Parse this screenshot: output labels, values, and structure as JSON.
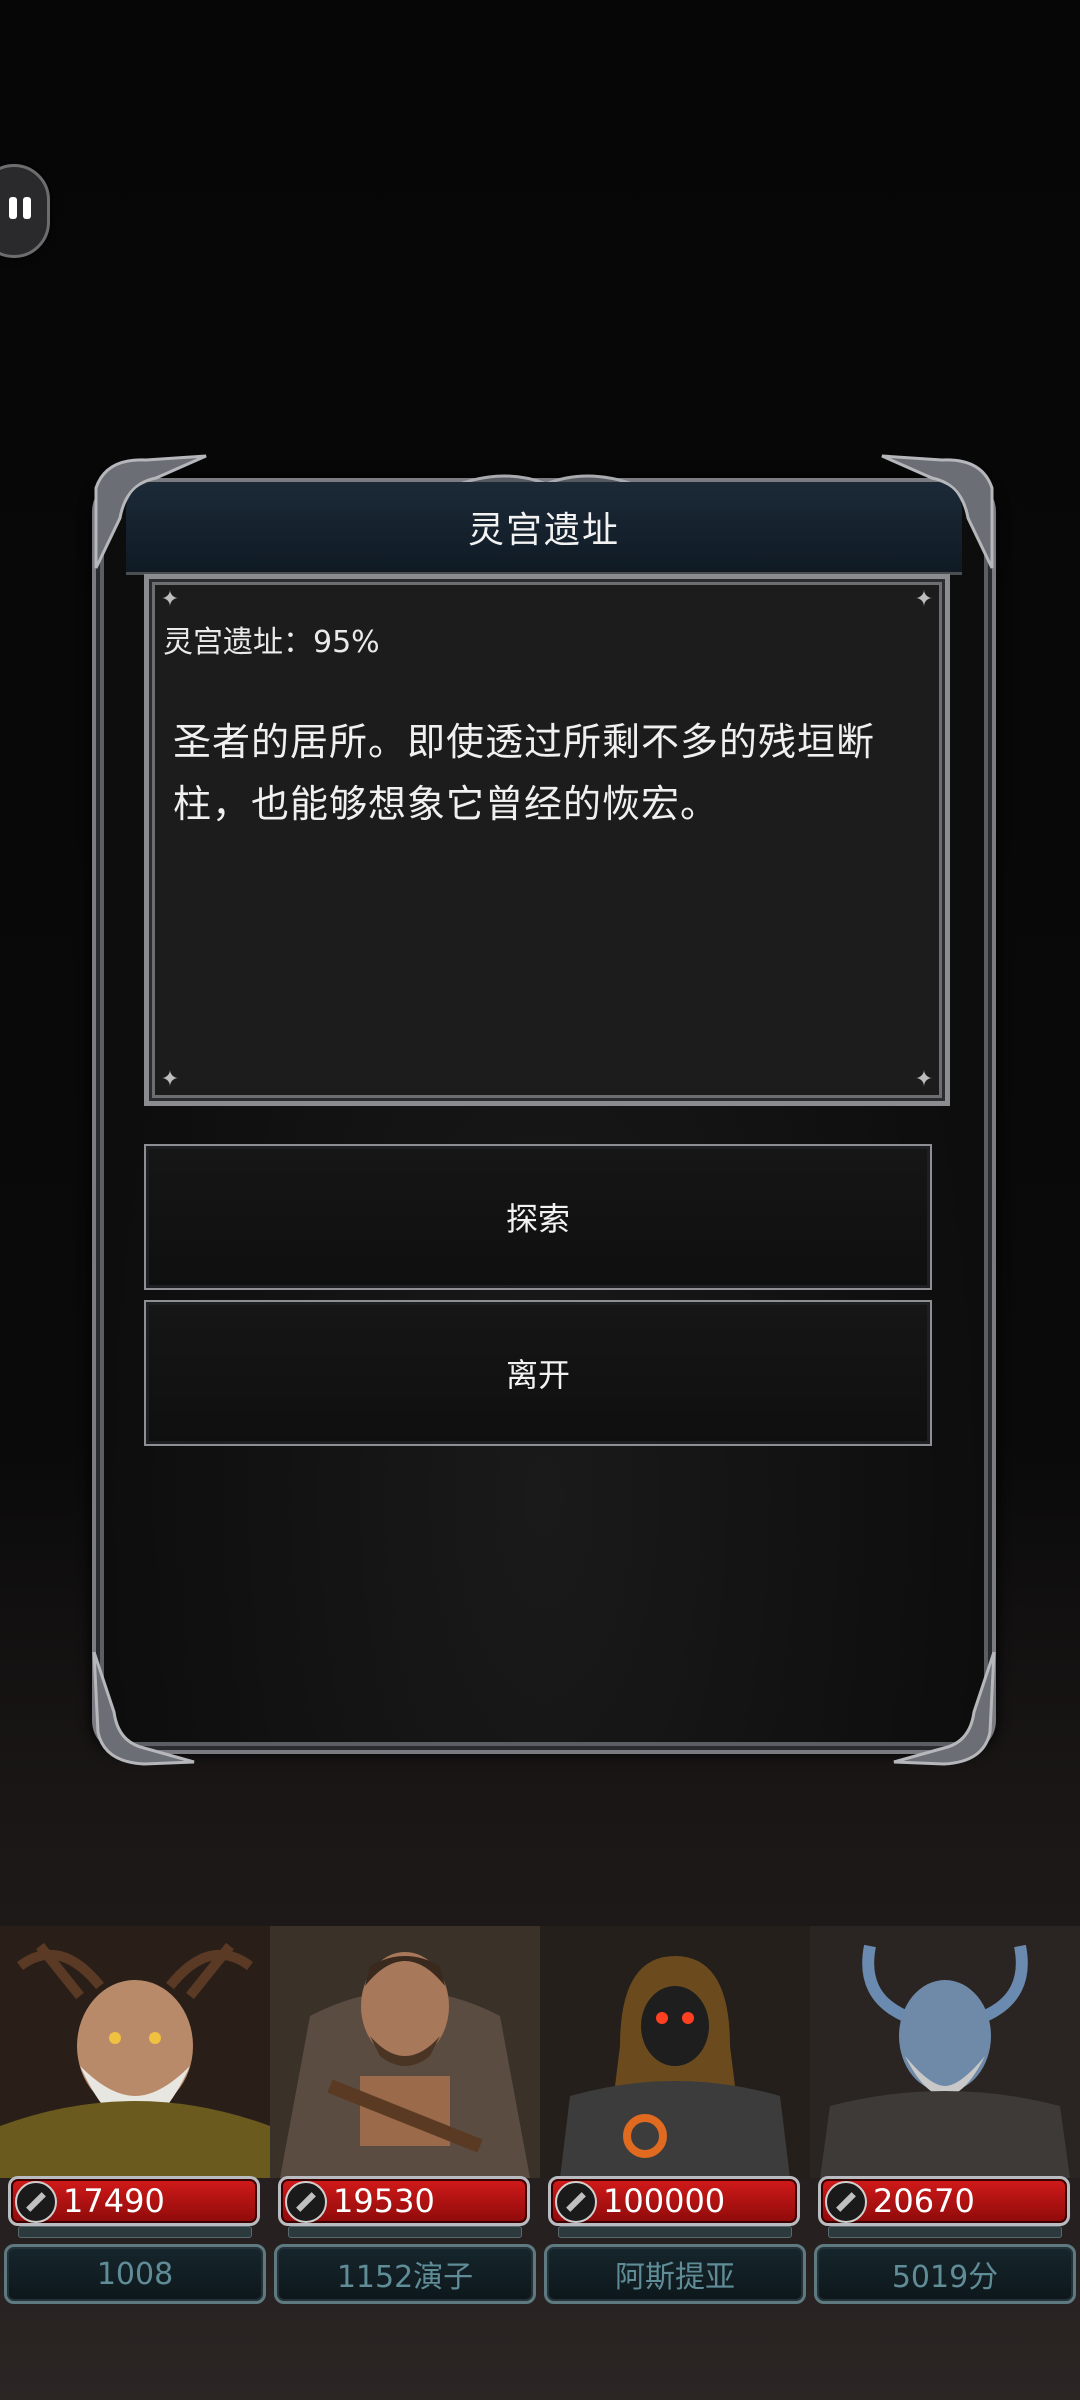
{
  "dialog": {
    "title": "灵宫遗址",
    "status": "灵宫遗址：95%",
    "description": "圣者的居所。即使透过所剩不多的残垣断柱，也能够想象它曾经的恢宏。",
    "progress_percent": 95,
    "actions": [
      {
        "label": "探索"
      },
      {
        "label": "离开"
      }
    ]
  },
  "party": [
    {
      "hp": "17490",
      "name": "1008",
      "portrait": "antlered-druid-elder"
    },
    {
      "hp": "19530",
      "name": "1152演子",
      "portrait": "fur-clad-barbarian"
    },
    {
      "hp": "100000",
      "name": "阿斯提亚",
      "portrait": "hooded-masked-mechanic"
    },
    {
      "hp": "20670",
      "name": "5019分",
      "portrait": "horned-frost-warrior"
    }
  ],
  "colors": {
    "hp_red": "#c41414",
    "frame_silver": "#8a8c90",
    "name_teal": "#5f8c96"
  }
}
